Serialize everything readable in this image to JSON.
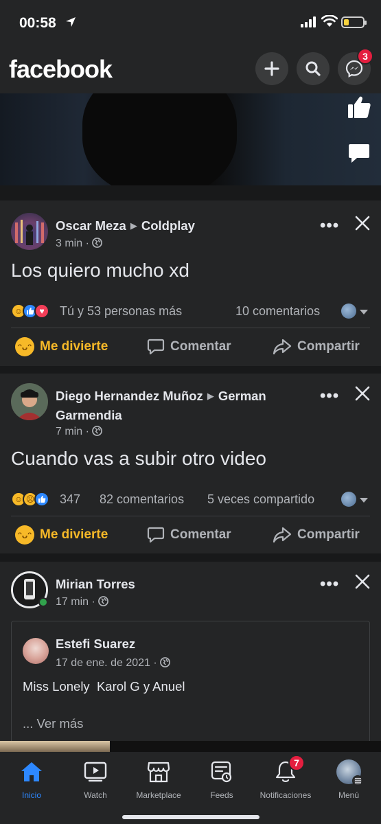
{
  "status_bar": {
    "time": "00:58"
  },
  "header": {
    "logo": "facebook",
    "messenger_badge": "3"
  },
  "posts": [
    {
      "author": "Oscar Meza",
      "target": "Coldplay",
      "time": "3 min",
      "text": "Los quiero mucho xd",
      "reactions_text": "Tú y 53 personas más",
      "comments": "10 comentarios",
      "reaction_set": [
        "haha-icon",
        "like-icon",
        "love-icon"
      ]
    },
    {
      "author": "Diego Hernandez Muñoz",
      "target": "German",
      "target_line2": "Garmendia",
      "time": "7 min",
      "text": "Cuando vas a subir otro video",
      "reaction_count": "347",
      "comments": "82 comentarios",
      "shares": "5 veces compartido",
      "reaction_set": [
        "haha-icon",
        "sad-icon",
        "like-icon"
      ]
    },
    {
      "author": "Mirian Torres",
      "time": "17 min",
      "shared": {
        "author": "Estefi Suarez",
        "date": "17 de ene. de 2021",
        "text": "Miss Lonely  Karol G y Anuel",
        "more": "... Ver más"
      }
    }
  ],
  "actions": {
    "haha": "Me divierte",
    "comment": "Comentar",
    "share": "Compartir"
  },
  "nav": {
    "items": [
      {
        "label": "Inicio",
        "icon": "home-icon"
      },
      {
        "label": "Watch",
        "icon": "watch-icon"
      },
      {
        "label": "Marketplace",
        "icon": "marketplace-icon"
      },
      {
        "label": "Feeds",
        "icon": "feeds-icon"
      },
      {
        "label": "Notificaciones",
        "icon": "bell-icon",
        "badge": "7"
      },
      {
        "label": "Menú",
        "icon": "menu-avatar-icon"
      }
    ]
  },
  "colors": {
    "accent": "#2d88ff",
    "haha": "#f7b928",
    "badge": "#e41e3f",
    "surface": "#242526",
    "background": "#18191a"
  }
}
